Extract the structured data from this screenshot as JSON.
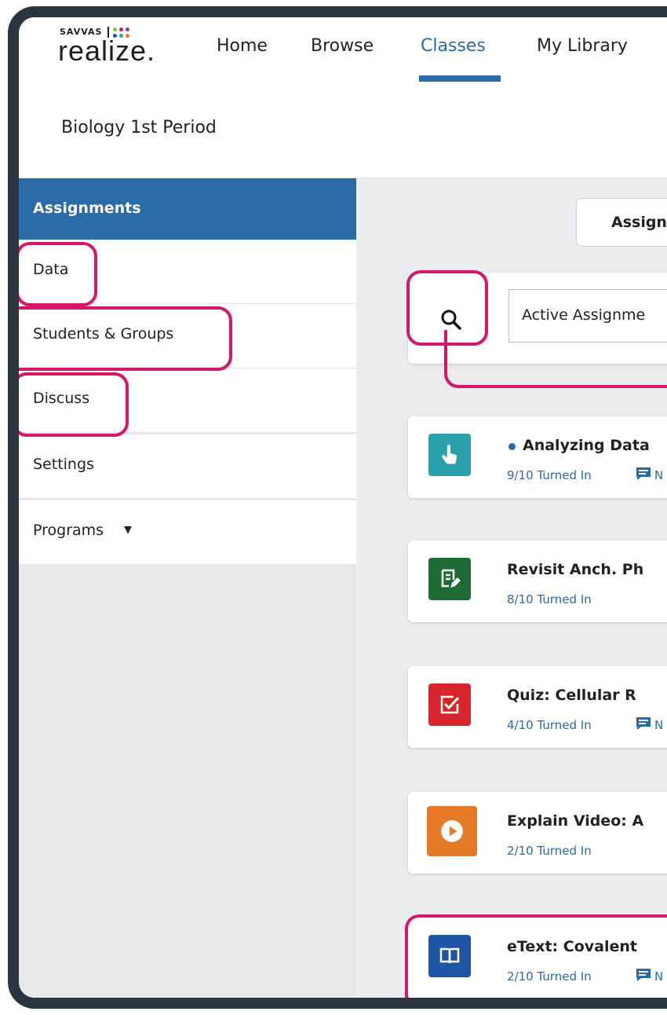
{
  "brand": {
    "company": "SAVVAS",
    "product": "realize."
  },
  "nav": {
    "home": "Home",
    "browse": "Browse",
    "classes": "Classes",
    "library": "My Library"
  },
  "class_name": "Biology 1st Period",
  "sidebar": {
    "items": [
      {
        "label": "Assignments"
      },
      {
        "label": "Data"
      },
      {
        "label": "Students & Groups"
      },
      {
        "label": "Discuss"
      },
      {
        "label": "Settings"
      },
      {
        "label": "Programs"
      }
    ],
    "programs_caret": "▾"
  },
  "main": {
    "assign_button": "Assign",
    "filter_value": "Active Assignme",
    "assignments": [
      {
        "title": "Analyzing Data",
        "turned_in": "9/10 Turned In",
        "messages": "N",
        "icon": "hand-pointer-icon",
        "color": "#2ba0ad",
        "new": true
      },
      {
        "title": "Revisit Anch. Ph",
        "turned_in": "8/10 Turned In",
        "messages": "",
        "icon": "notes-edit-icon",
        "color": "#1e6b35",
        "new": false
      },
      {
        "title": "Quiz: Cellular R",
        "turned_in": "4/10 Turned In",
        "messages": "N",
        "icon": "checkbox-icon",
        "color": "#d7262b",
        "new": false
      },
      {
        "title": "Explain Video: A",
        "turned_in": "2/10 Turned In",
        "messages": "",
        "icon": "play-icon",
        "color": "#e67a27",
        "new": false
      },
      {
        "title": "eText: Covalent",
        "turned_in": "2/10 Turned In",
        "messages": "N",
        "icon": "book-icon",
        "color": "#1f55a5",
        "new": false
      }
    ]
  },
  "colors": {
    "accent": "#2a6aa7",
    "callout": "#d4176c",
    "frame": "#2b3540"
  }
}
